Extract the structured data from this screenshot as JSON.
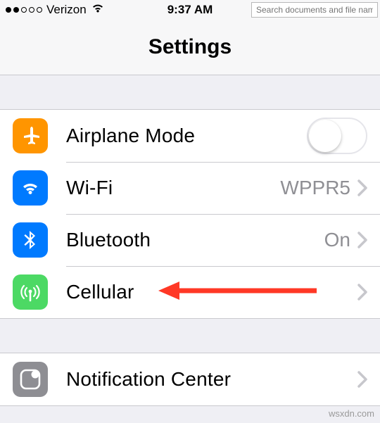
{
  "status_bar": {
    "carrier": "Verizon",
    "time": "9:37 AM",
    "signal_dots_filled": 2,
    "signal_dots_total": 5
  },
  "nav": {
    "title": "Settings"
  },
  "overlay": {
    "search_placeholder": "Search documents and file names fo"
  },
  "rows": {
    "airplane": {
      "label": "Airplane Mode",
      "icon": "airplane-icon",
      "color": "#ff9500",
      "toggle": false
    },
    "wifi": {
      "label": "Wi-Fi",
      "icon": "wifi-icon",
      "color": "#007aff",
      "value": "WPPR5"
    },
    "bluetooth": {
      "label": "Bluetooth",
      "icon": "bluetooth-icon",
      "color": "#007aff",
      "value": "On"
    },
    "cellular": {
      "label": "Cellular",
      "icon": "cellular-icon",
      "color": "#4cd964"
    },
    "notif": {
      "label": "Notification Center",
      "icon": "notification-center-icon",
      "color": "#8e8e93"
    }
  },
  "annotation": {
    "arrow_color": "#ff3b30"
  },
  "watermark": "wsxdn.com"
}
